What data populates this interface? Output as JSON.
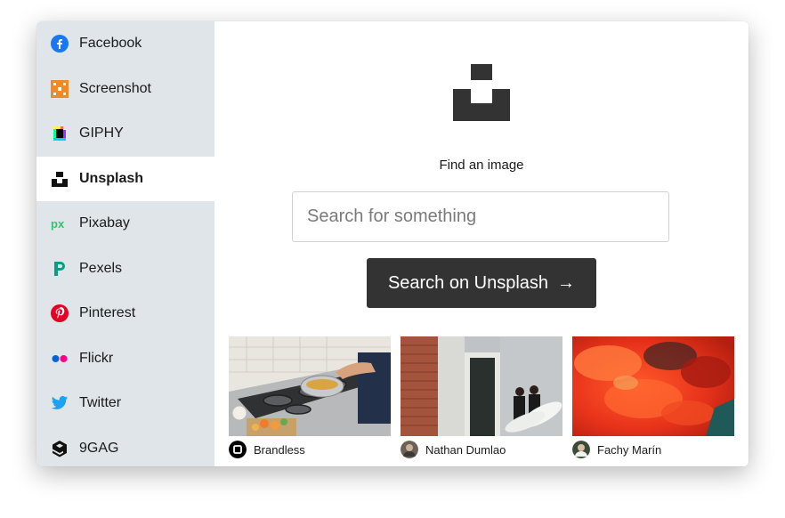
{
  "sidebar": {
    "items": [
      {
        "label": "Facebook",
        "icon": "facebook-icon",
        "color": "#1877f2"
      },
      {
        "label": "Screenshot",
        "icon": "screenshot-icon",
        "color": "#f08a24"
      },
      {
        "label": "GIPHY",
        "icon": "giphy-icon",
        "color": "#000000"
      },
      {
        "label": "Unsplash",
        "icon": "unsplash-icon",
        "color": "#111111",
        "active": true
      },
      {
        "label": "Pixabay",
        "icon": "pixabay-icon",
        "color": "#2ec66d"
      },
      {
        "label": "Pexels",
        "icon": "pexels-icon",
        "color": "#05a081"
      },
      {
        "label": "Pinterest",
        "icon": "pinterest-icon",
        "color": "#e60023"
      },
      {
        "label": "Flickr",
        "icon": "flickr-icon",
        "color": "#0063dc"
      },
      {
        "label": "Twitter",
        "icon": "twitter-icon",
        "color": "#1da1f2"
      },
      {
        "label": "9GAG",
        "icon": "9gag-icon",
        "color": "#000000"
      }
    ]
  },
  "main": {
    "logo_icon": "unsplash-logo-icon",
    "find_label": "Find an image",
    "search_placeholder": "Search for something",
    "search_value": "",
    "search_button_label": "Search on Unsplash",
    "search_button_arrow": "→"
  },
  "results": [
    {
      "credit": "Brandless",
      "image": "kitchen stove cooking"
    },
    {
      "credit": "Nathan Dumlao",
      "image": "two men with surfboards by door"
    },
    {
      "credit": "Fachy Marín",
      "image": "red orange clouds"
    }
  ]
}
